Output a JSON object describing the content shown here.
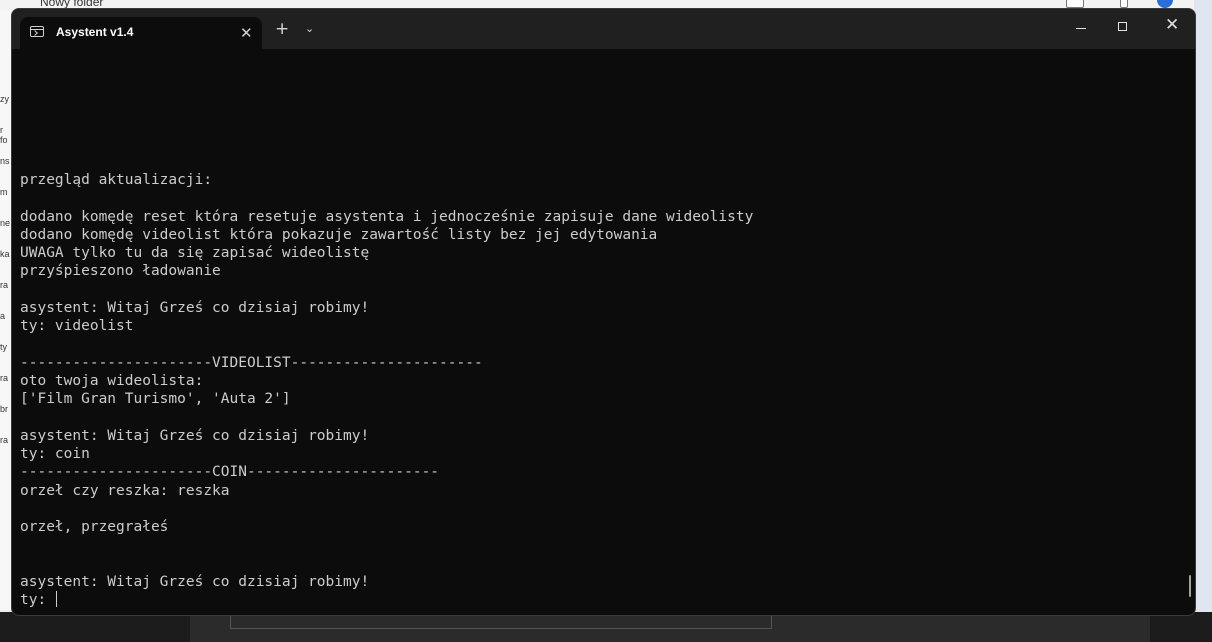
{
  "background": {
    "folder_label": "Nowy folder",
    "left_fragments": [
      "zy",
      "r fo",
      "ns",
      "m",
      "ne",
      "ka",
      "ra",
      "a",
      "ty",
      "ra",
      "br",
      "ra"
    ]
  },
  "window": {
    "tab_title": "Asystent v1.4",
    "tab_icon": "terminal-icon",
    "close_tab_glyph": "✕",
    "new_tab_glyph": "+",
    "dropdown_glyph": "⌄",
    "close_window_glyph": "✕"
  },
  "terminal": {
    "lines": [
      "przegląd aktualizacji:",
      "",
      "dodano komędę reset która resetuje asystenta i jednocześnie zapisuje dane wideolisty",
      "dodano komędę videolist która pokazuje zawartość listy bez jej edytowania",
      "UWAGA tylko tu da się zapisać wideolistę",
      "przyśpieszono ładowanie",
      "",
      "asystent: Witaj Grześ co dzisiaj robimy!",
      "ty: videolist",
      "",
      "----------------------VIDEOLIST----------------------",
      "oto twoja wideolista:",
      "['Film Gran Turismo', 'Auta 2']",
      "",
      "asystent: Witaj Grześ co dzisiaj robimy!",
      "ty: coin",
      "----------------------COIN----------------------",
      "orzeł czy reszka: reszka",
      "",
      "orzeł, przegrałeś",
      "",
      "",
      "asystent: Witaj Grześ co dzisiaj robimy!"
    ],
    "prompt": "ty: "
  },
  "colors": {
    "terminal_bg": "#0c0c0c",
    "titlebar_bg": "#202020",
    "text": "#cccccc"
  }
}
